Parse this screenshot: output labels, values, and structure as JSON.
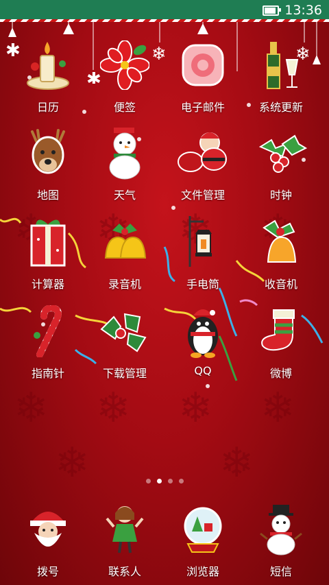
{
  "status_bar": {
    "time": "13:36",
    "battery_level": 0.8,
    "battery_icon": "battery-icon"
  },
  "apps": [
    {
      "label": "日历",
      "icon": "calendar-candle-icon"
    },
    {
      "label": "便签",
      "icon": "poinsettia-icon"
    },
    {
      "label": "电子邮件",
      "icon": "email-gift-icon"
    },
    {
      "label": "系统更新",
      "icon": "champagne-icon"
    },
    {
      "label": "地图",
      "icon": "reindeer-icon"
    },
    {
      "label": "天气",
      "icon": "snowman-icon"
    },
    {
      "label": "文件管理",
      "icon": "santa-sack-icon"
    },
    {
      "label": "时钟",
      "icon": "holly-icon"
    },
    {
      "label": "计算器",
      "icon": "gift-box-icon"
    },
    {
      "label": "录音机",
      "icon": "bells-icon"
    },
    {
      "label": "手电筒",
      "icon": "lantern-icon"
    },
    {
      "label": "收音机",
      "icon": "bell-holly-icon"
    },
    {
      "label": "指南针",
      "icon": "candy-cane-icon"
    },
    {
      "label": "下载管理",
      "icon": "holly-leaves-icon"
    },
    {
      "label": "QQ",
      "icon": "penguin-icon"
    },
    {
      "label": "微博",
      "icon": "stocking-icon"
    }
  ],
  "page_indicator": {
    "count": 4,
    "active": 1
  },
  "dock": [
    {
      "label": "拨号",
      "icon": "santa-face-icon"
    },
    {
      "label": "联系人",
      "icon": "girl-icon"
    },
    {
      "label": "浏览器",
      "icon": "snow-globe-icon"
    },
    {
      "label": "短信",
      "icon": "snowman-hat-icon"
    }
  ],
  "colors": {
    "status_bar": "#1f7d53",
    "background": "#b0101a"
  }
}
